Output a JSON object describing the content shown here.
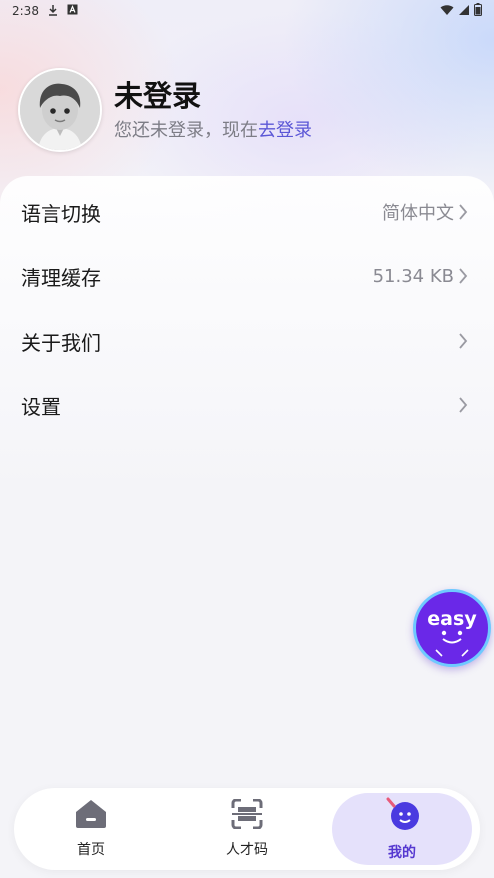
{
  "status_bar": {
    "time": "2:38",
    "icons": [
      "download-icon",
      "notification-a-icon",
      "wifi-icon",
      "signal-icon",
      "battery-icon"
    ]
  },
  "profile": {
    "name": "未登录",
    "subtitle_prefix": "您还未登录，现在",
    "login_link": "去登录",
    "link_color": "#5b57d6"
  },
  "menu": [
    {
      "label": "语言切换",
      "value": "简体中文"
    },
    {
      "label": "清理缓存",
      "value": "51.34 KB"
    },
    {
      "label": "关于我们",
      "value": ""
    },
    {
      "label": "设置",
      "value": ""
    }
  ],
  "floating_button": {
    "text": "easy"
  },
  "bottom_nav": [
    {
      "label": "首页",
      "icon": "home-icon"
    },
    {
      "label": "人才码",
      "icon": "scan-code-icon"
    },
    {
      "label": "我的",
      "icon": "profile-face-icon"
    }
  ],
  "colors": {
    "accent": "#5538d0",
    "active_tab_bg": "#e5e1fb",
    "float_bg": "#6a28e8"
  }
}
